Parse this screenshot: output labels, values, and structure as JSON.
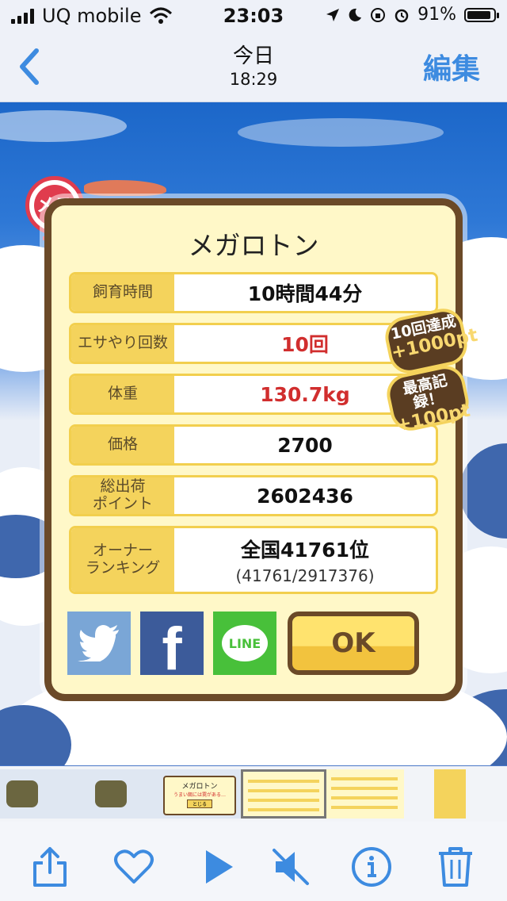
{
  "status_bar": {
    "carrier": "UQ mobile",
    "time": "23:03",
    "battery": "91%",
    "battery_level": 0.91
  },
  "nav": {
    "title": "今日",
    "subtitle": "18:29",
    "edit_label": "編集"
  },
  "card": {
    "badge_label": "メス",
    "title": "メガロトン",
    "rows": [
      {
        "label": "飼育時間",
        "value": "10時間44分"
      },
      {
        "label": "エサやり回数",
        "value": "10回"
      },
      {
        "label": "体重",
        "value": "130.7kg"
      },
      {
        "label": "価格",
        "value": "2700"
      },
      {
        "label": "総出荷\nポイント",
        "value": "2602436"
      },
      {
        "label": "オーナー\nランキング",
        "value": "全国41761位",
        "sub": "(41761/2917376)"
      }
    ],
    "bonus1": {
      "top": "10回達成",
      "bottom": "+1000pt"
    },
    "bonus2": {
      "top": "最高記録！",
      "bottom": "+100pt"
    },
    "share": {
      "line_label": "LINE"
    },
    "ok_label": "OK"
  },
  "thumbnail_strip": {
    "preview_title": "メガロトン",
    "preview_note": "うまい餌には罠がある…",
    "preview_button": "とじる"
  },
  "colors": {
    "accent": "#3d8be0",
    "card_border": "#6b4a28",
    "label_yellow": "#f4d35c",
    "highlight_red": "#d12e2e"
  }
}
